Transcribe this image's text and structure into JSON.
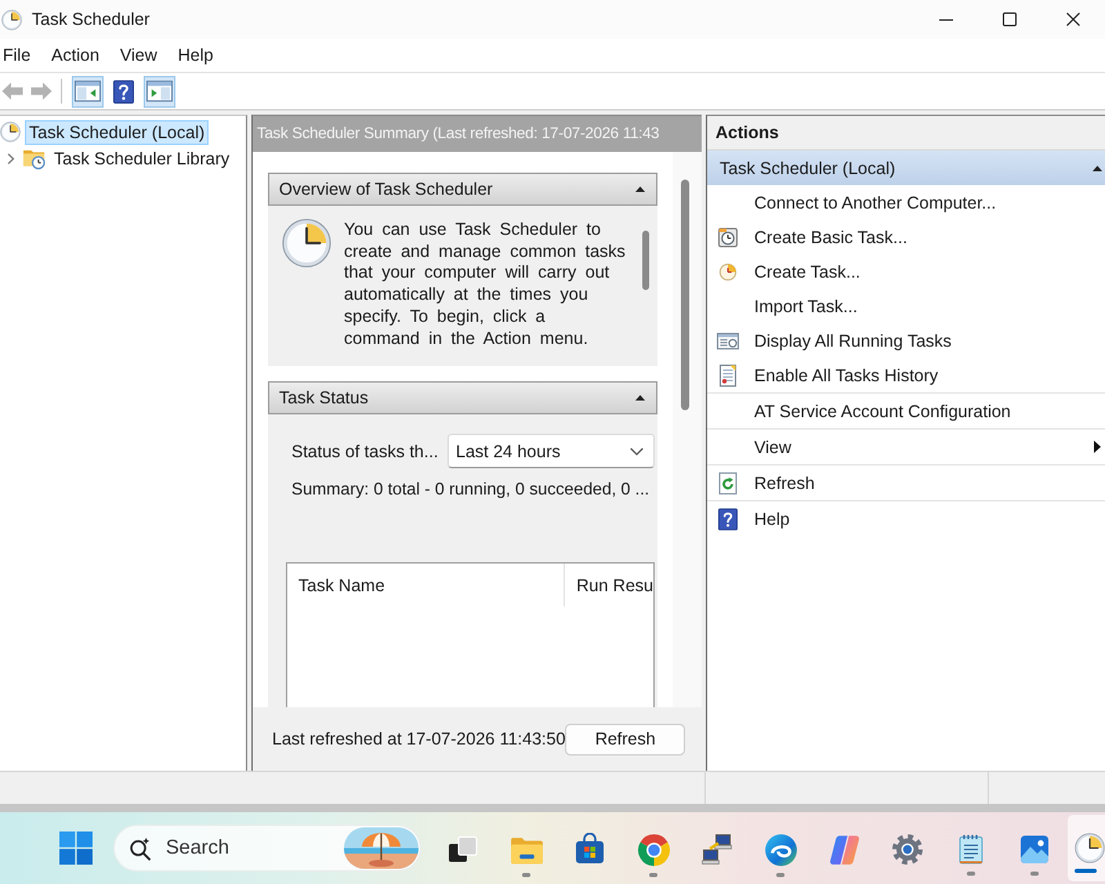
{
  "window": {
    "title": "Task Scheduler"
  },
  "menu": [
    "File",
    "Action",
    "View",
    "Help"
  ],
  "toolbar": [
    {
      "disabled": true,
      "pressed": false
    },
    {
      "disabled": true,
      "pressed": false
    },
    {
      "disabled": false,
      "pressed": true
    },
    {
      "disabled": false,
      "pressed": false
    },
    {
      "disabled": false,
      "pressed": true
    }
  ],
  "tree": [
    {
      "label": "Task Scheduler (Local)",
      "selected": true,
      "children": [
        {
          "label": "Task Scheduler Library",
          "selected": false,
          "expanded": false
        }
      ]
    }
  ],
  "summary": {
    "title": "Task Scheduler Summary (Last refreshed: 17-07-2026 11:43",
    "sections": [
      {
        "kind": "overview",
        "title": "Overview of Task Scheduler",
        "expanded": true,
        "text": "You can use Task Scheduler to create and manage common tasks that your computer will carry out automatically at the times you specify. To begin, click a command in the Action menu."
      },
      {
        "kind": "status",
        "title": "Task Status",
        "expanded": true,
        "filter_label": "Status of tasks th...",
        "filter": {
          "value": "Last 24 hours"
        },
        "summary": "Summary: 0 total - 0 running, 0 succeeded, 0 ...",
        "table": {
          "columns": [
            "Task Name",
            "Run Resu"
          ]
        }
      }
    ],
    "last_refreshed": "Last refreshed at 17-07-2026 11:43:50",
    "refresh_button": "Refresh"
  },
  "actions": {
    "title": "Actions",
    "group": {
      "title": "Task Scheduler (Local)",
      "expanded": true,
      "items": [
        {
          "label": "Connect to Another Computer...",
          "submenu": false,
          "divider": false
        },
        {
          "label": "Create Basic Task...",
          "submenu": false,
          "divider": false
        },
        {
          "label": "Create Task...",
          "submenu": false,
          "divider": false
        },
        {
          "label": "Import Task...",
          "submenu": false,
          "divider": false
        },
        {
          "label": "Display All Running Tasks",
          "submenu": false,
          "divider": false
        },
        {
          "label": "Enable All Tasks History",
          "submenu": false,
          "divider": true
        },
        {
          "label": "AT Service Account Configuration",
          "submenu": false,
          "divider": true
        },
        {
          "label": "View",
          "submenu": true,
          "divider": true
        },
        {
          "label": "Refresh",
          "submenu": false,
          "divider": true
        },
        {
          "label": "Help",
          "submenu": false,
          "divider": false
        }
      ]
    }
  },
  "taskbar": {
    "search": {
      "placeholder": "Search"
    },
    "apps": [
      {
        "running": false,
        "selected": false
      },
      {
        "running": true,
        "selected": false
      },
      {
        "running": false,
        "selected": false
      },
      {
        "running": true,
        "selected": false
      },
      {
        "running": false,
        "selected": false
      },
      {
        "running": true,
        "selected": false
      },
      {
        "running": false,
        "selected": false
      },
      {
        "running": false,
        "selected": false
      },
      {
        "running": true,
        "selected": false
      },
      {
        "running": true,
        "selected": false
      },
      {
        "running": true,
        "selected": true
      }
    ]
  }
}
